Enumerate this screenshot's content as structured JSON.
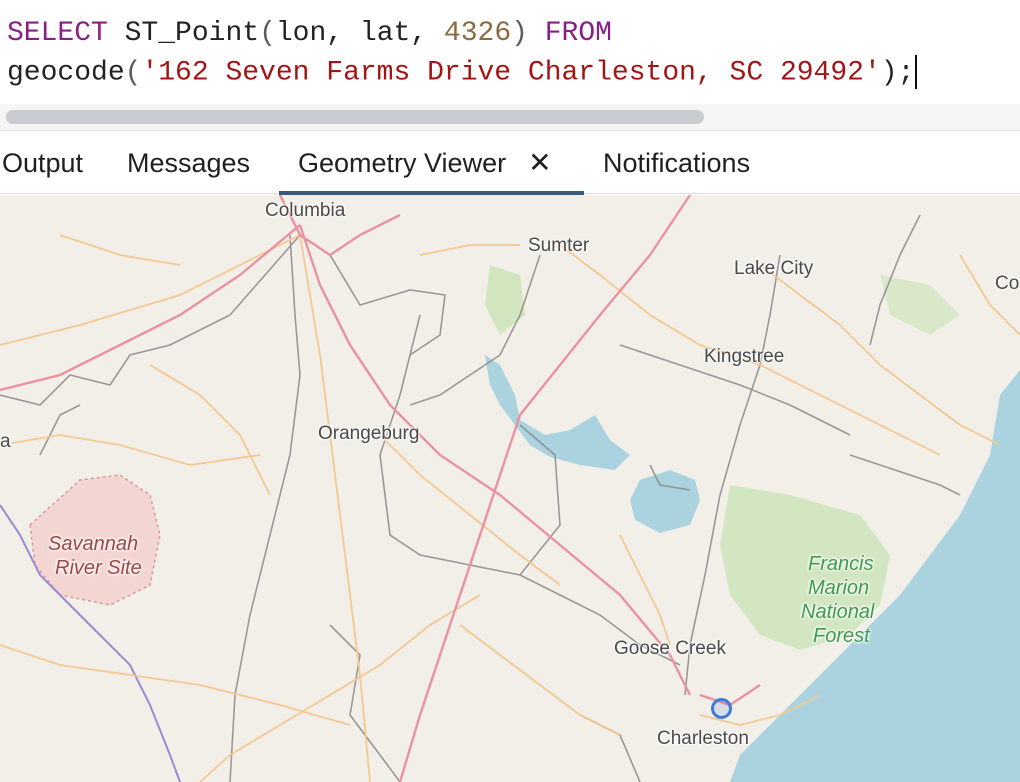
{
  "editor": {
    "line1": {
      "kw_select": "SELECT",
      "fn": " ST_Point",
      "open": "(",
      "args": "lon, lat, ",
      "srid": "4326",
      "close": ")",
      "kw_from": " FROM"
    },
    "line2": {
      "fn": "geocode",
      "open": "(",
      "address": "'162 Seven Farms Drive Charleston, SC 29492'",
      "close": ");"
    }
  },
  "tabs": [
    {
      "label": "Output",
      "active": false
    },
    {
      "label": "Messages",
      "active": false
    },
    {
      "label": "Geometry Viewer",
      "active": true
    },
    {
      "label": "Notifications",
      "active": false
    }
  ],
  "close_glyph": "✕",
  "map": {
    "places": {
      "columbia": "Columbia",
      "sumter": "Sumter",
      "lake_city": "Lake City",
      "co": "Co",
      "kingstree": "Kingstree",
      "orangeburg": "Orangeburg",
      "a": "a",
      "savannah": "Savannah",
      "river_site": "River Site",
      "francis": "Francis",
      "marion": "Marion",
      "national": "National",
      "forest": "Forest",
      "goose_creek": "Goose Creek",
      "charleston": "Charleston"
    },
    "colors": {
      "land": "#f2efe9",
      "water": "#aad3df",
      "forest": "#c8e3b4",
      "highway": "#e892a2",
      "road": "#f4c68e",
      "admin": "#8a8a8a",
      "marker": "#3c7bd6"
    }
  }
}
